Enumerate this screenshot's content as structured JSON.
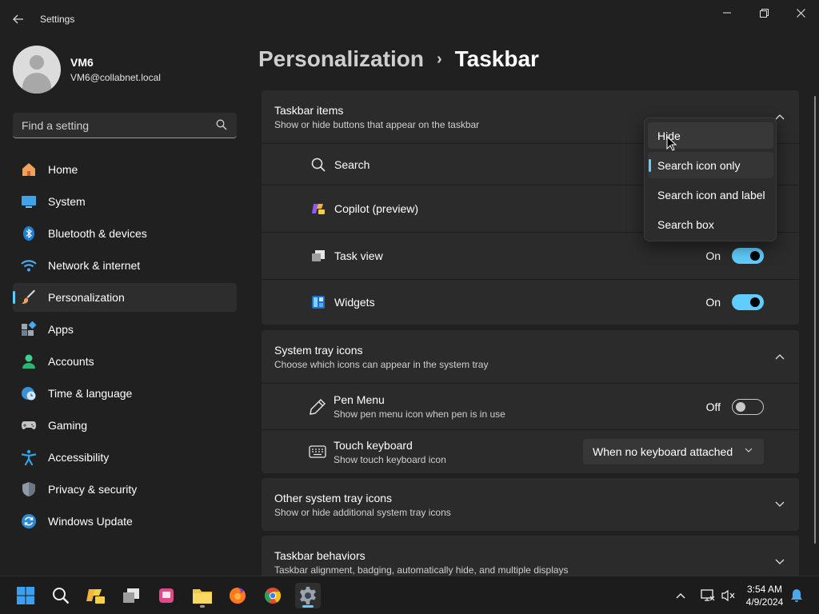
{
  "window": {
    "title": "Settings"
  },
  "profile": {
    "name": "VM6",
    "email": "VM6@collabnet.local"
  },
  "search": {
    "placeholder": "Find a setting"
  },
  "sidebar": {
    "items": [
      {
        "label": "Home",
        "icon": "home-icon"
      },
      {
        "label": "System",
        "icon": "system-icon"
      },
      {
        "label": "Bluetooth & devices",
        "icon": "bluetooth-icon"
      },
      {
        "label": "Network & internet",
        "icon": "wifi-icon"
      },
      {
        "label": "Personalization",
        "icon": "brush-icon",
        "active": true
      },
      {
        "label": "Apps",
        "icon": "apps-icon"
      },
      {
        "label": "Accounts",
        "icon": "person-icon"
      },
      {
        "label": "Time & language",
        "icon": "clock-globe-icon"
      },
      {
        "label": "Gaming",
        "icon": "gamepad-icon"
      },
      {
        "label": "Accessibility",
        "icon": "accessibility-icon"
      },
      {
        "label": "Privacy & security",
        "icon": "shield-icon"
      },
      {
        "label": "Windows Update",
        "icon": "update-icon"
      }
    ]
  },
  "breadcrumb": {
    "parent": "Personalization",
    "separator": "›",
    "current": "Taskbar"
  },
  "sections": {
    "taskbar_items": {
      "title": "Taskbar items",
      "subtitle": "Show or hide buttons that appear on the taskbar",
      "rows": {
        "search": {
          "label": "Search"
        },
        "copilot": {
          "label": "Copilot (preview)"
        },
        "task_view": {
          "label": "Task view",
          "state": "On",
          "on": true
        },
        "widgets": {
          "label": "Widgets",
          "state": "On",
          "on": true
        }
      }
    },
    "system_tray": {
      "title": "System tray icons",
      "subtitle": "Choose which icons can appear in the system tray",
      "rows": {
        "pen_menu": {
          "label": "Pen Menu",
          "desc": "Show pen menu icon when pen is in use",
          "state": "Off",
          "on": false
        },
        "touch_keyboard": {
          "label": "Touch keyboard",
          "desc": "Show touch keyboard icon",
          "value": "When no keyboard attached"
        }
      }
    },
    "other_tray": {
      "title": "Other system tray icons",
      "subtitle": "Show or hide additional system tray icons"
    },
    "behaviors": {
      "title": "Taskbar behaviors",
      "subtitle": "Taskbar alignment, badging, automatically hide, and multiple displays"
    }
  },
  "search_dropdown": {
    "options": [
      "Hide",
      "Search icon only",
      "Search icon and label",
      "Search box"
    ],
    "selected": "Search icon only",
    "hovered": "Hide"
  },
  "taskbar": {
    "clock": {
      "time": "3:54 AM",
      "date": "4/9/2024"
    }
  },
  "colors": {
    "accent": "#60cdff",
    "background": "#202020",
    "card": "#2b2b2b"
  }
}
